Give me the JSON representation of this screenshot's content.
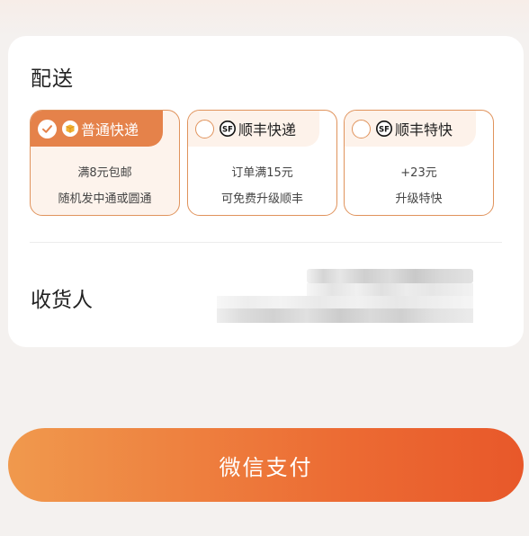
{
  "delivery": {
    "title": "配送",
    "options": [
      {
        "name": "普通快递",
        "line1": "满8元包邮",
        "line2": "随机发中通或圆通",
        "selected": true,
        "icon": "box-icon"
      },
      {
        "name": "顺丰快递",
        "line1": "订单满15元",
        "line2": "可免费升级顺丰",
        "selected": false,
        "icon": "sf-logo-icon"
      },
      {
        "name": "顺丰特快",
        "line1": "+23元",
        "line2": "升级特快",
        "selected": false,
        "icon": "sf-logo-icon"
      }
    ]
  },
  "receiver": {
    "label": "收货人"
  },
  "pay_button": {
    "label": "微信支付"
  },
  "colors": {
    "accent": "#e5824a",
    "accent_border": "#e0935c",
    "button_gradient_start": "#f0994d",
    "button_gradient_end": "#e8582a",
    "background": "#f4f1ef"
  }
}
